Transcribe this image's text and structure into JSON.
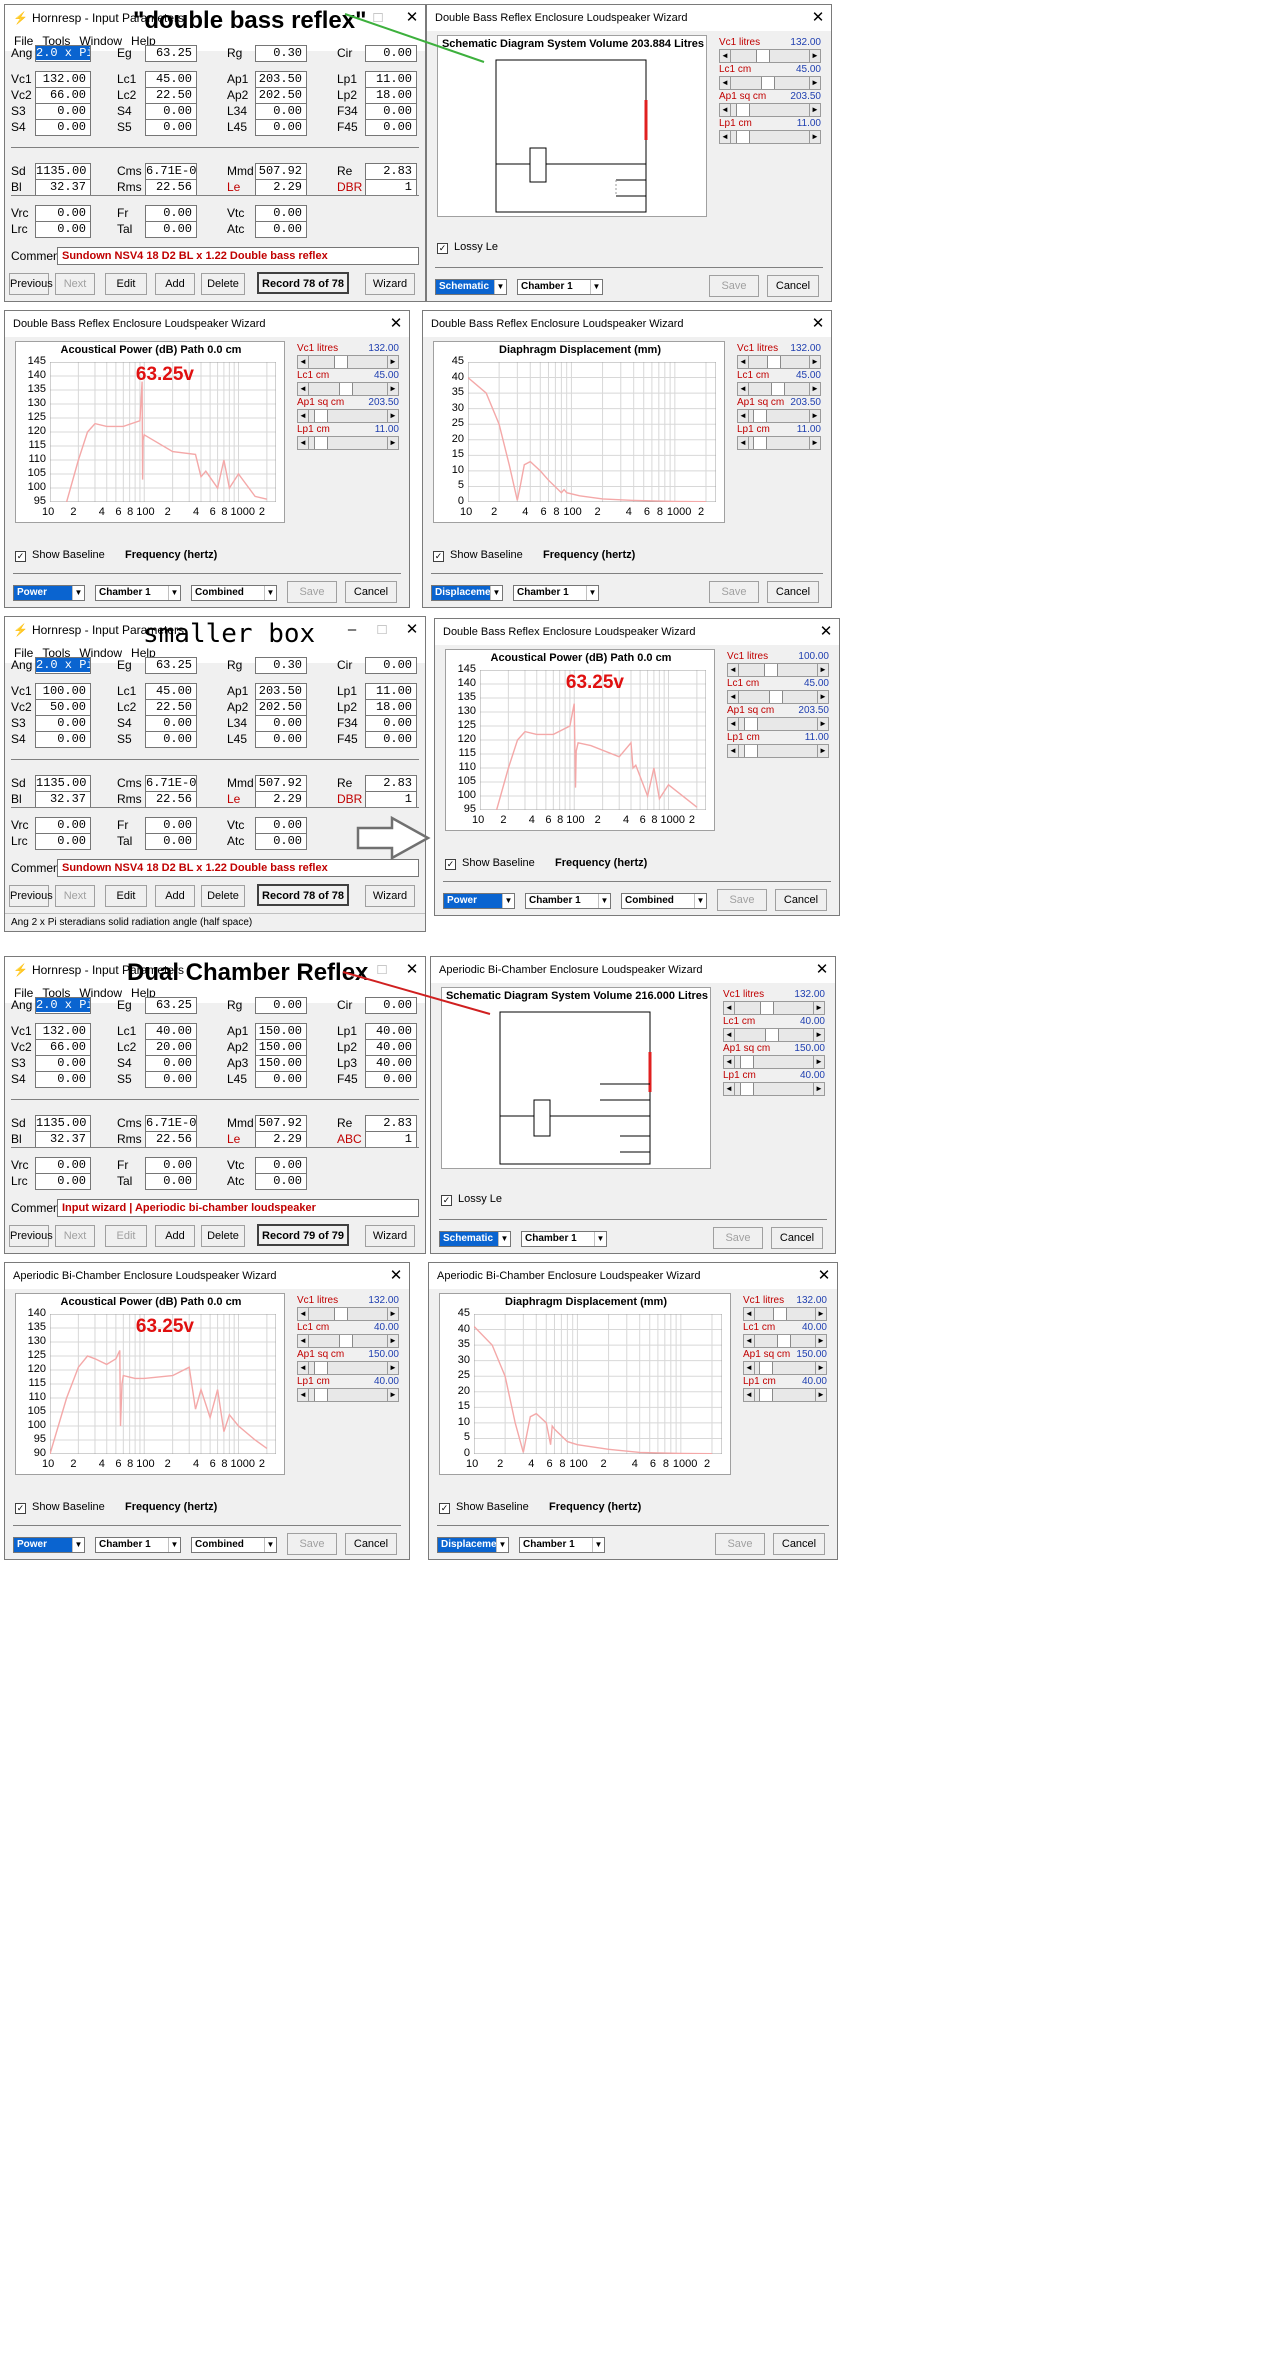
{
  "labels": {
    "double_bass_reflex": "\"double bass reflex\"",
    "smaller_box": "smaller box",
    "dual_chamber_reflex": "Dual Chamber Reflex"
  },
  "input_windows": [
    {
      "title": "Hornresp - Input Parameters",
      "menu": [
        "File",
        "Tools",
        "Window",
        "Help"
      ],
      "fields": [
        [
          "Ang",
          "2.0 x Pi",
          "Eg",
          "63.25",
          "Rg",
          "0.30",
          "Cir",
          "0.00"
        ],
        [
          "Vc1",
          "132.00",
          "Lc1",
          "45.00",
          "Ap1",
          "203.50",
          "Lp1",
          "11.00"
        ],
        [
          "Vc2",
          "66.00",
          "Lc2",
          "22.50",
          "Ap2",
          "202.50",
          "Lp2",
          "18.00"
        ],
        [
          "S3",
          "0.00",
          "S4",
          "0.00",
          "L34",
          "0.00",
          "F34",
          "0.00"
        ],
        [
          "S4",
          "0.00",
          "S5",
          "0.00",
          "L45",
          "0.00",
          "F45",
          "0.00"
        ],
        [
          "Sd",
          "1135.00",
          "Cms",
          "6.71E-05",
          "Mmd",
          "507.92",
          "Re",
          "2.83"
        ],
        [
          "Bl",
          "32.37",
          "Rms",
          "22.56",
          "Le",
          "2.29",
          "DBR",
          "1"
        ],
        [
          "Vrc",
          "0.00",
          "Fr",
          "0.00",
          "Vtc",
          "0.00"
        ],
        [
          "Lrc",
          "0.00",
          "Tal",
          "0.00",
          "Atc",
          "0.00"
        ]
      ],
      "comment_label": "Comment",
      "comment": "Sundown NSV4 18 D2 BL x 1.22  Double bass reflex",
      "buttons": [
        "Previous",
        "Next",
        "Edit",
        "Add",
        "Delete",
        "Wizard"
      ],
      "record": "Record 78 of 78"
    },
    {
      "title": "Hornresp - Input Parameters",
      "menu": [
        "File",
        "Tools",
        "Window",
        "Help"
      ],
      "fields": [
        [
          "Ang",
          "2.0 x Pi",
          "Eg",
          "63.25",
          "Rg",
          "0.30",
          "Cir",
          "0.00"
        ],
        [
          "Vc1",
          "100.00",
          "Lc1",
          "45.00",
          "Ap1",
          "203.50",
          "Lp1",
          "11.00"
        ],
        [
          "Vc2",
          "50.00",
          "Lc2",
          "22.50",
          "Ap2",
          "202.50",
          "Lp2",
          "18.00"
        ],
        [
          "S3",
          "0.00",
          "S4",
          "0.00",
          "L34",
          "0.00",
          "F34",
          "0.00"
        ],
        [
          "S4",
          "0.00",
          "S5",
          "0.00",
          "L45",
          "0.00",
          "F45",
          "0.00"
        ],
        [
          "Sd",
          "1135.00",
          "Cms",
          "6.71E-05",
          "Mmd",
          "507.92",
          "Re",
          "2.83"
        ],
        [
          "Bl",
          "32.37",
          "Rms",
          "22.56",
          "Le",
          "2.29",
          "DBR",
          "1"
        ],
        [
          "Vrc",
          "0.00",
          "Fr",
          "0.00",
          "Vtc",
          "0.00"
        ],
        [
          "Lrc",
          "0.00",
          "Tal",
          "0.00",
          "Atc",
          "0.00"
        ]
      ],
      "comment_label": "Comment",
      "comment": "Sundown NSV4 18 D2 BL x 1.22  Double bass reflex",
      "buttons": [
        "Previous",
        "Next",
        "Edit",
        "Add",
        "Delete",
        "Wizard"
      ],
      "record": "Record 78 of 78",
      "status": "Ang  2 x Pi steradians solid radiation angle  (half space)"
    },
    {
      "title": "Hornresp - Input Parameters",
      "menu": [
        "File",
        "Tools",
        "Window",
        "Help"
      ],
      "fields": [
        [
          "Ang",
          "2.0 x Pi",
          "Eg",
          "63.25",
          "Rg",
          "0.00",
          "Cir",
          "0.00"
        ],
        [
          "Vc1",
          "132.00",
          "Lc1",
          "40.00",
          "Ap1",
          "150.00",
          "Lp1",
          "40.00"
        ],
        [
          "Vc2",
          "66.00",
          "Lc2",
          "20.00",
          "Ap2",
          "150.00",
          "Lp2",
          "40.00"
        ],
        [
          "S3",
          "0.00",
          "S4",
          "0.00",
          "Ap3",
          "150.00",
          "Lp3",
          "40.00"
        ],
        [
          "S4",
          "0.00",
          "S5",
          "0.00",
          "L45",
          "0.00",
          "F45",
          "0.00"
        ],
        [
          "Sd",
          "1135.00",
          "Cms",
          "6.71E-05",
          "Mmd",
          "507.92",
          "Re",
          "2.83"
        ],
        [
          "Bl",
          "32.37",
          "Rms",
          "22.56",
          "Le",
          "2.29",
          "ABC",
          "1"
        ],
        [
          "Vrc",
          "0.00",
          "Fr",
          "0.00",
          "Vtc",
          "0.00"
        ],
        [
          "Lrc",
          "0.00",
          "Tal",
          "0.00",
          "Atc",
          "0.00"
        ]
      ],
      "comment_label": "Comment",
      "comment": "Input wizard | Aperiodic bi-chamber loudspeaker",
      "buttons": [
        "Previous",
        "Next",
        "Edit",
        "Add",
        "Delete",
        "Wizard"
      ],
      "record": "Record 79 of 79"
    }
  ],
  "wizards": [
    {
      "title": "Double Bass Reflex Enclosure Loudspeaker Wizard",
      "kind": "schematic",
      "chart_title": "Schematic Diagram   System Volume 203.884 Litres",
      "sliders": [
        [
          "Vc1  litres",
          "132.00"
        ],
        [
          "Lc1  cm",
          "45.00"
        ],
        [
          "Ap1  sq cm",
          "203.50"
        ],
        [
          "Lp1  cm",
          "11.00"
        ]
      ],
      "lossy": "Lossy Le",
      "combos": [
        "Schematic",
        "Chamber 1"
      ],
      "buttons": [
        "Save",
        "Cancel"
      ]
    },
    {
      "title": "Double Bass Reflex Enclosure Loudspeaker Wizard",
      "kind": "power",
      "chart_title": "Acoustical Power (dB)   Path 0.0 cm",
      "voltage": "63.25v",
      "sliders": [
        [
          "Vc1  litres",
          "132.00"
        ],
        [
          "Lc1  cm",
          "45.00"
        ],
        [
          "Ap1  sq cm",
          "203.50"
        ],
        [
          "Lp1  cm",
          "11.00"
        ]
      ],
      "baseline": "Show Baseline",
      "xlabel": "Frequency (hertz)",
      "combos": [
        "Power",
        "Chamber 1",
        "Combined"
      ],
      "buttons": [
        "Save",
        "Cancel"
      ]
    },
    {
      "title": "Double Bass Reflex Enclosure Loudspeaker Wizard",
      "kind": "displacement",
      "chart_title": "Diaphragm Displacement (mm)",
      "sliders": [
        [
          "Vc1  litres",
          "132.00"
        ],
        [
          "Lc1  cm",
          "45.00"
        ],
        [
          "Ap1  sq cm",
          "203.50"
        ],
        [
          "Lp1  cm",
          "11.00"
        ]
      ],
      "baseline": "Show Baseline",
      "xlabel": "Frequency (hertz)",
      "combos": [
        "Displacement",
        "Chamber 1"
      ],
      "buttons": [
        "Save",
        "Cancel"
      ]
    },
    {
      "title": "Double Bass Reflex Enclosure Loudspeaker Wizard",
      "kind": "power",
      "chart_title": "Acoustical Power (dB)   Path 0.0 cm",
      "voltage": "63.25v",
      "sliders": [
        [
          "Vc1  litres",
          "100.00"
        ],
        [
          "Lc1  cm",
          "45.00"
        ],
        [
          "Ap1  sq cm",
          "203.50"
        ],
        [
          "Lp1  cm",
          "11.00"
        ]
      ],
      "baseline": "Show Baseline",
      "xlabel": "Frequency (hertz)",
      "combos": [
        "Power",
        "Chamber 1",
        "Combined"
      ],
      "buttons": [
        "Save",
        "Cancel"
      ]
    },
    {
      "title": "Aperiodic Bi-Chamber Enclosure Loudspeaker Wizard",
      "kind": "schematic",
      "chart_title": "Schematic Diagram   System Volume 216.000 Litres",
      "sliders": [
        [
          "Vc1  litres",
          "132.00"
        ],
        [
          "Lc1  cm",
          "40.00"
        ],
        [
          "Ap1  sq cm",
          "150.00"
        ],
        [
          "Lp1  cm",
          "40.00"
        ]
      ],
      "lossy": "Lossy Le",
      "combos": [
        "Schematic",
        "Chamber 1"
      ],
      "buttons": [
        "Save",
        "Cancel"
      ]
    },
    {
      "title": "Aperiodic Bi-Chamber Enclosure Loudspeaker Wizard",
      "kind": "power",
      "chart_title": "Acoustical Power (dB)   Path 0.0 cm",
      "voltage": "63.25v",
      "sliders": [
        [
          "Vc1  litres",
          "132.00"
        ],
        [
          "Lc1  cm",
          "40.00"
        ],
        [
          "Ap1  sq cm",
          "150.00"
        ],
        [
          "Lp1  cm",
          "40.00"
        ]
      ],
      "baseline": "Show Baseline",
      "xlabel": "Frequency (hertz)",
      "combos": [
        "Power",
        "Chamber 1",
        "Combined"
      ],
      "buttons": [
        "Save",
        "Cancel"
      ]
    },
    {
      "title": "Aperiodic Bi-Chamber Enclosure Loudspeaker Wizard",
      "kind": "displacement",
      "chart_title": "Diaphragm Displacement (mm)",
      "sliders": [
        [
          "Vc1  litres",
          "132.00"
        ],
        [
          "Lc1  cm",
          "40.00"
        ],
        [
          "Ap1  sq cm",
          "150.00"
        ],
        [
          "Lp1  cm",
          "40.00"
        ]
      ],
      "baseline": "Show Baseline",
      "xlabel": "Frequency (hertz)",
      "combos": [
        "Displacement",
        "Chamber 1"
      ],
      "buttons": [
        "Save",
        "Cancel"
      ]
    }
  ],
  "chart_data": [
    {
      "type": "line",
      "title": "Acoustical Power (dB)   Path 0.0 cm",
      "xlabel": "Frequency (hertz)",
      "ylabel": "",
      "x_scale": "log",
      "xlim": [
        10,
        20000
      ],
      "ylim": [
        95,
        145
      ],
      "x_tick_labels": [
        "10",
        "2",
        "4",
        "6",
        "8",
        "100",
        "2",
        "4",
        "6",
        "8",
        "1000",
        "2"
      ],
      "y_ticks": [
        95,
        100,
        105,
        110,
        115,
        120,
        125,
        130,
        135,
        140,
        145
      ],
      "grid": true,
      "series": [
        {
          "x": [
            15,
            20,
            25,
            30,
            40,
            60,
            90,
            95,
            96,
            97,
            100,
            200,
            350,
            400,
            450,
            600,
            700,
            800,
            1000,
            1500,
            2000
          ],
          "y": [
            95,
            110,
            120,
            123,
            122,
            122,
            124,
            138,
            103,
            117,
            119,
            113,
            112,
            104,
            106,
            100,
            110,
            100,
            105,
            97,
            96
          ]
        }
      ]
    },
    {
      "type": "line",
      "title": "Diaphragm Displacement (mm)",
      "xlabel": "Frequency (hertz)",
      "ylabel": "",
      "x_scale": "log",
      "xlim": [
        10,
        20000
      ],
      "ylim": [
        0,
        45
      ],
      "x_tick_labels": [
        "10",
        "2",
        "4",
        "6",
        "8",
        "100",
        "2",
        "4",
        "6",
        "8",
        "1000",
        "2"
      ],
      "y_ticks": [
        0,
        5,
        10,
        15,
        20,
        25,
        30,
        35,
        40,
        45
      ],
      "grid": true,
      "series": [
        {
          "x": [
            10,
            15,
            20,
            25,
            30,
            32,
            35,
            40,
            50,
            60,
            80,
            85,
            90,
            120,
            200,
            400,
            1000,
            2000
          ],
          "y": [
            40,
            35,
            25,
            12,
            0.5,
            5,
            12,
            13,
            10,
            7,
            3,
            4,
            3,
            2,
            1,
            0.5,
            0.2,
            0.1
          ]
        }
      ]
    },
    {
      "type": "line",
      "title": "Acoustical Power (dB)   Path 0.0 cm",
      "xlabel": "Frequency (hertz)",
      "ylabel": "",
      "x_scale": "log",
      "xlim": [
        10,
        20000
      ],
      "ylim": [
        95,
        145
      ],
      "x_tick_labels": [
        "10",
        "2",
        "4",
        "6",
        "8",
        "100",
        "2",
        "4",
        "6",
        "8",
        "1000",
        "2"
      ],
      "y_ticks": [
        95,
        100,
        105,
        110,
        115,
        120,
        125,
        130,
        135,
        140,
        145
      ],
      "grid": true,
      "series": [
        {
          "x": [
            15,
            20,
            25,
            30,
            40,
            60,
            90,
            100,
            103,
            105,
            110,
            150,
            300,
            400,
            420,
            450,
            600,
            700,
            800,
            1000,
            2000
          ],
          "y": [
            95,
            110,
            120,
            123,
            122,
            122,
            125,
            133,
            103,
            116,
            119,
            118,
            114,
            119,
            110,
            111,
            100,
            110,
            99,
            104,
            96
          ]
        }
      ]
    },
    {
      "type": "line",
      "title": "Acoustical Power (dB)   Path 0.0 cm",
      "xlabel": "Frequency (hertz)",
      "ylabel": "",
      "x_scale": "log",
      "xlim": [
        10,
        20000
      ],
      "ylim": [
        90,
        140
      ],
      "x_tick_labels": [
        "10",
        "2",
        "4",
        "6",
        "8",
        "100",
        "2",
        "4",
        "6",
        "8",
        "1000",
        "2"
      ],
      "y_ticks": [
        90,
        95,
        100,
        105,
        110,
        115,
        120,
        125,
        130,
        135,
        140
      ],
      "grid": true,
      "series": [
        {
          "x": [
            10,
            15,
            20,
            25,
            30,
            40,
            50,
            55,
            56,
            58,
            60,
            80,
            100,
            200,
            300,
            350,
            400,
            500,
            600,
            700,
            800,
            1000,
            1500,
            2000
          ],
          "y": [
            90,
            110,
            121,
            125,
            124,
            122,
            124,
            127,
            100,
            115,
            118,
            117,
            117,
            118,
            121,
            106,
            113,
            103,
            113,
            98,
            104,
            100,
            95,
            92
          ]
        }
      ]
    },
    {
      "type": "line",
      "title": "Diaphragm Displacement (mm)",
      "xlabel": "Frequency (hertz)",
      "ylabel": "",
      "x_scale": "log",
      "xlim": [
        10,
        20000
      ],
      "ylim": [
        0,
        45
      ],
      "x_tick_labels": [
        "10",
        "2",
        "4",
        "6",
        "8",
        "100",
        "2",
        "4",
        "6",
        "8",
        "1000",
        "2"
      ],
      "y_ticks": [
        0,
        5,
        10,
        15,
        20,
        25,
        30,
        35,
        40,
        45
      ],
      "grid": true,
      "series": [
        {
          "x": [
            10,
            15,
            20,
            25,
            30,
            35,
            40,
            50,
            55,
            57,
            60,
            80,
            100,
            200,
            400,
            1000,
            2000
          ],
          "y": [
            41,
            35,
            25,
            10,
            0.5,
            12,
            13,
            10,
            3,
            9,
            8,
            4,
            3,
            1.5,
            0.5,
            0.2,
            0.1
          ]
        }
      ]
    }
  ],
  "colors": {
    "curve": "#f4a8a8",
    "voltage": "#e01010",
    "field_red": "#c00000",
    "link_blue": "#0a64d0",
    "green_line": "#3db03d",
    "red_line": "#d02020"
  }
}
